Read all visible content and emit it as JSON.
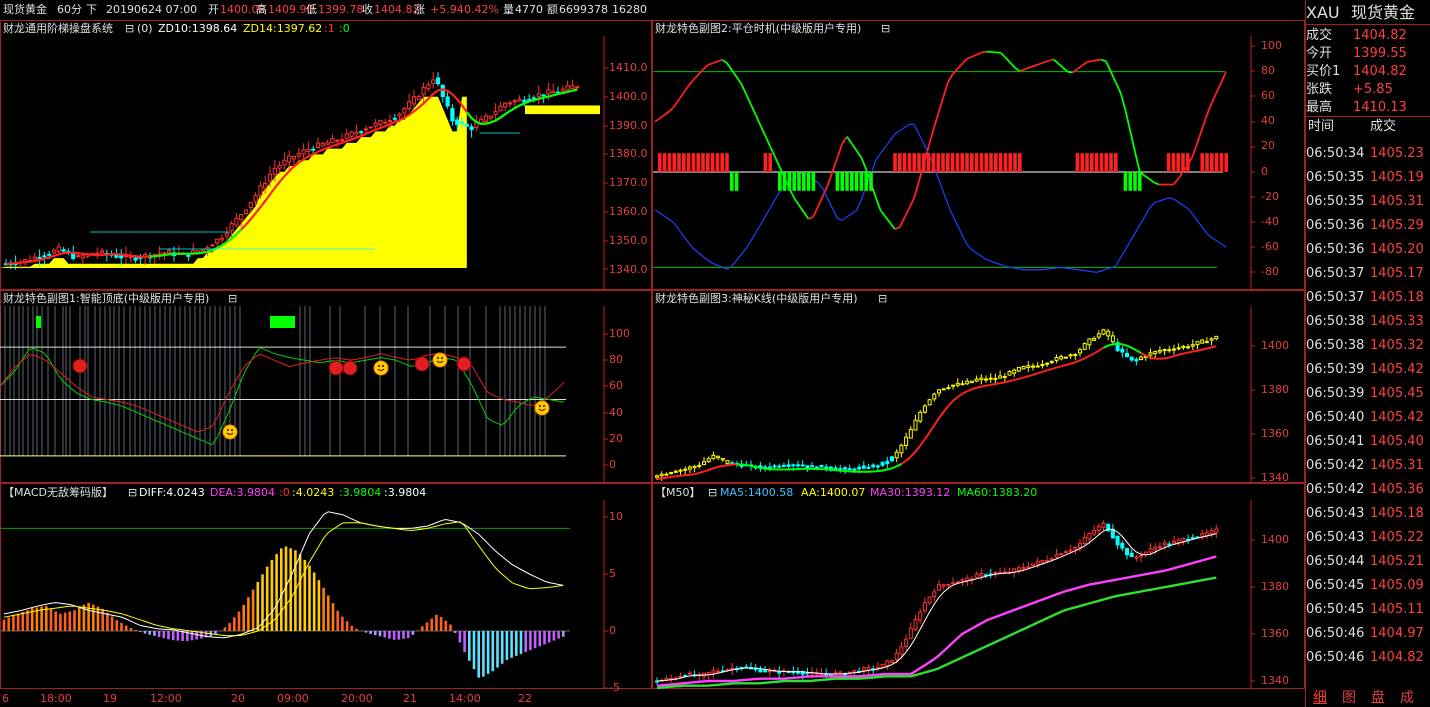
{
  "top_bar": {
    "symbol": "现货黄金",
    "period": "60分",
    "dir": "下",
    "datetime": "20190624 07:00",
    "open_label": "开",
    "open": "1400.08",
    "high_label": "高",
    "high": "1409.90",
    "low_label": "低",
    "low": "1399.78",
    "close_label": "收",
    "close": "1404.82",
    "chg_label": "涨",
    "chg": "+5.94",
    "pct": "0.42%",
    "vol_label": "量",
    "vol": "4770",
    "amt_label": "额",
    "amt": "6699378",
    "extra": "16280"
  },
  "panel1": {
    "title": "财龙通用阶梯操盘系统",
    "toggle": "⊟",
    "arg": "(0)",
    "zd10": "ZD10:1398.64",
    "zd14": "ZD14:1397.62",
    "v1": ":1",
    "v0": ":0",
    "yticks": [
      "1410.0",
      "1400.0",
      "1390.0",
      "1380.0",
      "1370.0",
      "1360.0",
      "1350.0",
      "1340.0"
    ]
  },
  "panel2": {
    "title": "财龙特色副图2:平仓时机(中级版用户专用)",
    "toggle": "⊟",
    "yticks": [
      "100",
      "80",
      "60",
      "40",
      "20",
      "0",
      "-20",
      "-40",
      "-60",
      "-80"
    ]
  },
  "panel3": {
    "title": "财龙特色副图1:智能顶底(中级版用户专用)",
    "toggle": "⊟",
    "yticks": [
      "100",
      "80",
      "60",
      "40",
      "20",
      "0"
    ]
  },
  "panel4": {
    "title": "财龙特色副图3:神秘K线(中级版用户专用)",
    "toggle": "⊟",
    "yticks": [
      "1400",
      "1380",
      "1360",
      "1340"
    ]
  },
  "panel5": {
    "title": "【MACD无敌筹码版】",
    "toggle": "⊟",
    "diff": "DIFF:4.0243",
    "dea": "DEA:3.9804",
    "z": ":0",
    "a": ":4.0243",
    "b": ":3.9804",
    "c": ":3.9804",
    "yticks": [
      "10",
      "5",
      "0",
      "-5"
    ]
  },
  "panel6": {
    "title": "【M50】",
    "toggle": "⊟",
    "ma5": "MA5:1400.58",
    "aa": "AA:1400.07",
    "ma30": "MA30:1393.12",
    "ma60": "MA60:1383.20",
    "yticks": [
      "1400",
      "1380",
      "1360",
      "1340"
    ]
  },
  "x_axis": [
    "6",
    "18:00",
    "19",
    "12:00",
    "20",
    "09:00",
    "20:00",
    "21",
    "14:00",
    "22"
  ],
  "right_panel": {
    "code": "XAU",
    "name": "现货黄金",
    "quote": [
      {
        "label": "成交",
        "value": "1404.82"
      },
      {
        "label": "今开",
        "value": "1399.55"
      },
      {
        "label": "买价1",
        "value": "1404.82"
      },
      {
        "label": "张跌",
        "value": "+5.85"
      },
      {
        "label": "最高",
        "value": "1410.13"
      }
    ],
    "tick_header_time": "时间",
    "tick_header_price": "成交",
    "ticks": [
      {
        "time": "06:50:34",
        "price": "1405.23"
      },
      {
        "time": "06:50:35",
        "price": "1405.19"
      },
      {
        "time": "06:50:35",
        "price": "1405.31"
      },
      {
        "time": "06:50:36",
        "price": "1405.29"
      },
      {
        "time": "06:50:36",
        "price": "1405.20"
      },
      {
        "time": "06:50:37",
        "price": "1405.17"
      },
      {
        "time": "06:50:37",
        "price": "1405.18"
      },
      {
        "time": "06:50:38",
        "price": "1405.33"
      },
      {
        "time": "06:50:38",
        "price": "1405.32"
      },
      {
        "time": "06:50:39",
        "price": "1405.42"
      },
      {
        "time": "06:50:39",
        "price": "1405.45"
      },
      {
        "time": "06:50:40",
        "price": "1405.42"
      },
      {
        "time": "06:50:41",
        "price": "1405.40"
      },
      {
        "time": "06:50:42",
        "price": "1405.31"
      },
      {
        "time": "06:50:42",
        "price": "1405.36"
      },
      {
        "time": "06:50:43",
        "price": "1405.18"
      },
      {
        "time": "06:50:43",
        "price": "1405.22"
      },
      {
        "time": "06:50:44",
        "price": "1405.21"
      },
      {
        "time": "06:50:45",
        "price": "1405.09"
      },
      {
        "time": "06:50:45",
        "price": "1405.11"
      },
      {
        "time": "06:50:46",
        "price": "1404.97"
      },
      {
        "time": "06:50:46",
        "price": "1404.82"
      }
    ],
    "tabs": [
      "细",
      "图",
      "盘",
      "成"
    ]
  }
}
